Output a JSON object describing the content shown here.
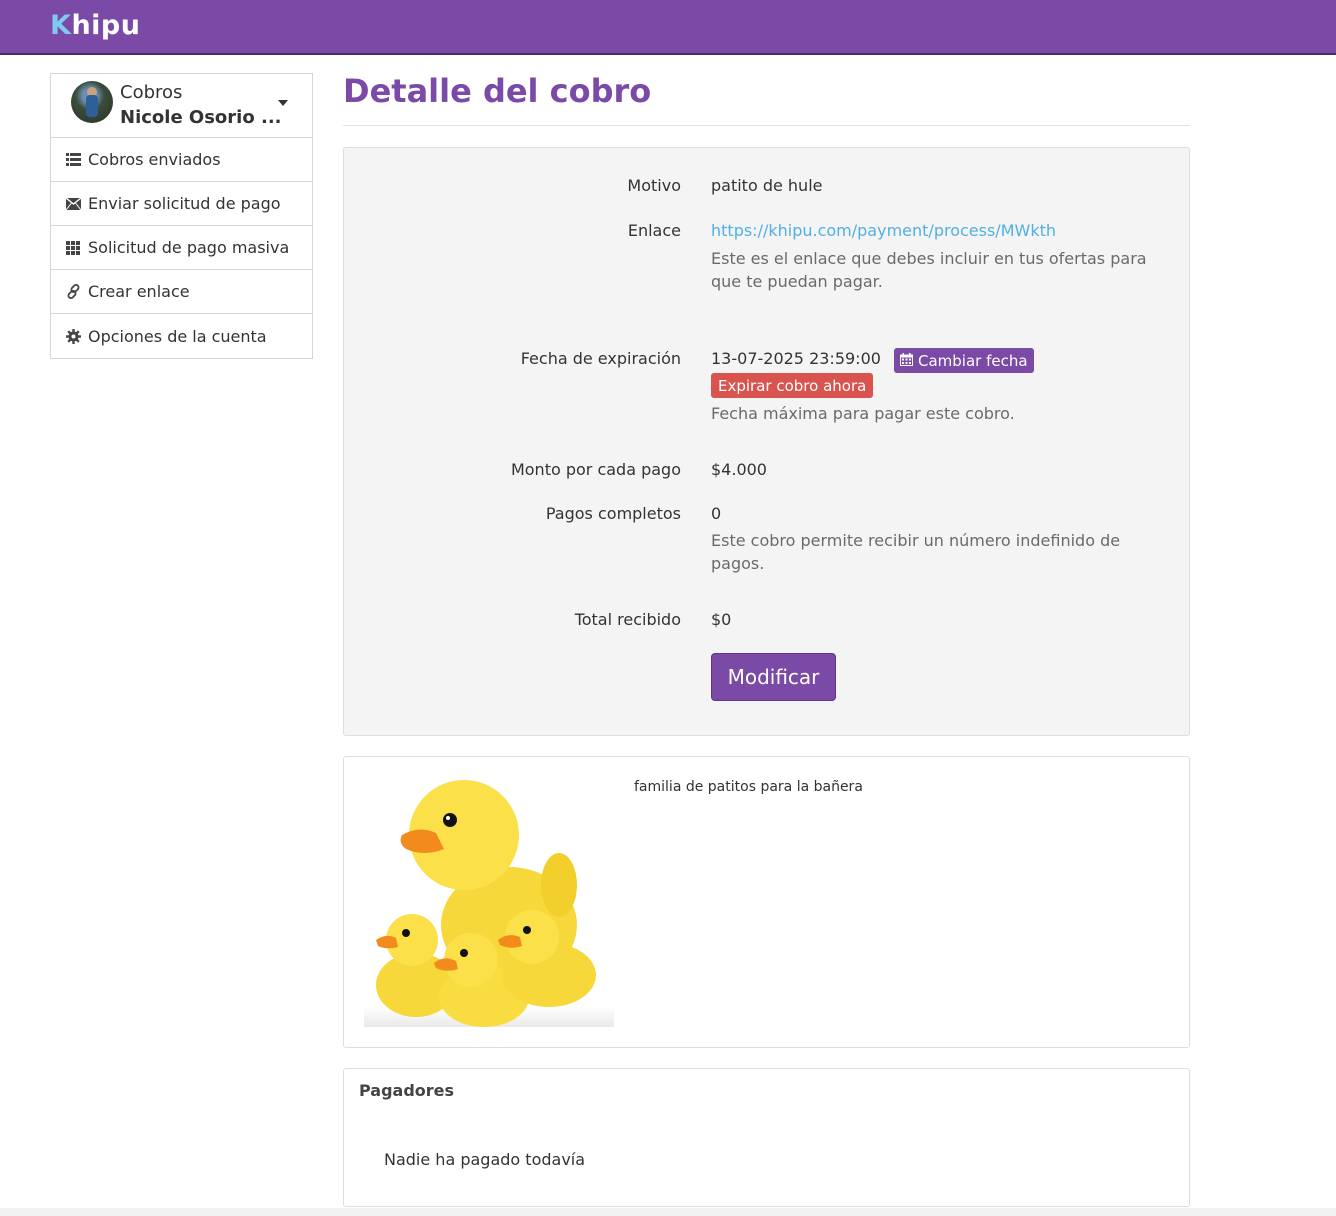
{
  "header": {
    "logo_k": "K",
    "logo_rest": "hipu"
  },
  "sidebar": {
    "title": "Cobros",
    "user": "Nicole Osorio ...",
    "items": [
      {
        "label": "Cobros enviados",
        "icon": "list-icon"
      },
      {
        "label": "Enviar solicitud de pago",
        "icon": "envelope-icon"
      },
      {
        "label": "Solicitud de pago masiva",
        "icon": "grid-icon"
      },
      {
        "label": "Crear enlace",
        "icon": "link-icon"
      },
      {
        "label": "Opciones de la cuenta",
        "icon": "gear-icon"
      }
    ]
  },
  "main": {
    "title": "Detalle del cobro",
    "details": {
      "motivo_label": "Motivo",
      "motivo_value": "patito de hule",
      "enlace_label": "Enlace",
      "enlace_value": "https://khipu.com/payment/process/MWkth",
      "enlace_help": "Este es el enlace que debes incluir en tus ofertas para que te puedan pagar.",
      "fecha_label": "Fecha de expiración",
      "fecha_value": "13-07-2025 23:59:00",
      "cambiar_fecha": "Cambiar fecha",
      "expirar": "Expirar cobro ahora",
      "fecha_help": "Fecha máxima para pagar este cobro.",
      "monto_label": "Monto por cada pago",
      "monto_value": "$4.000",
      "pagos_label": "Pagos completos",
      "pagos_value": "0",
      "pagos_help": "Este cobro permite recibir un número indefinido de pagos.",
      "total_label": "Total recibido",
      "total_value": "$0",
      "modificar": "Modificar"
    },
    "image_caption": "familia de patitos para la bañera",
    "payers": {
      "title": "Pagadores",
      "empty": "Nadie ha pagado todavía"
    }
  },
  "colors": {
    "brand": "#7b4aa6",
    "link": "#4fb0e6",
    "danger": "#d9534f"
  }
}
